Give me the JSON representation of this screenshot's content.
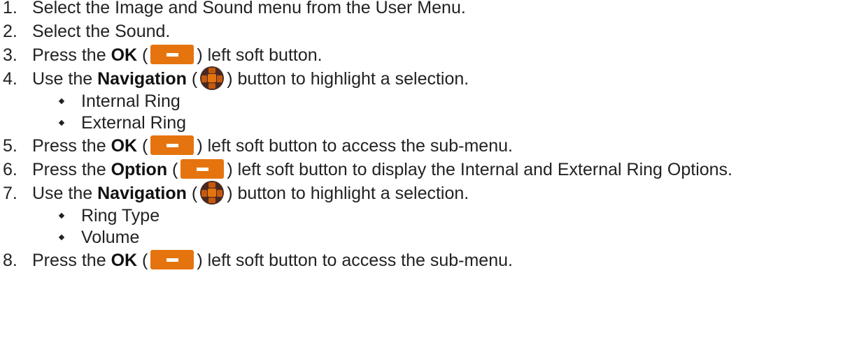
{
  "steps": [
    {
      "num": "1.",
      "text": "Select the Image and Sound menu from the User Menu."
    },
    {
      "num": "2.",
      "text": "Select the Sound."
    },
    {
      "num": "3.",
      "pre": "Press the ",
      "bold": "OK",
      "open": " (",
      "close": ") left soft button."
    },
    {
      "num": "4.",
      "pre": "Use the ",
      "bold": "Navigation",
      "open": " (",
      "close": ") button to highlight a selection.",
      "subitems": [
        "Internal Ring",
        "External Ring"
      ]
    },
    {
      "num": "5.",
      "pre": "Press the ",
      "bold": "OK",
      "open": " (",
      "close": ") left soft button to access the sub-menu."
    },
    {
      "num": "6.",
      "pre": "Press the ",
      "bold": "Option",
      "open": " (",
      "close": ") left soft button to display the Internal and External Ring Options."
    },
    {
      "num": "7.",
      "pre": "Use the ",
      "bold": "Navigation",
      "open": " (",
      "close": ") button to highlight a selection.",
      "subitems": [
        "Ring Type",
        "Volume"
      ]
    },
    {
      "num": "8.",
      "pre": "Press the ",
      "bold": "OK",
      "open": " (",
      "close": ") left soft button to access the sub-menu."
    }
  ],
  "icons": {
    "soft_button": "left-soft-button-icon",
    "navigation": "navigation-button-icon",
    "soft_button_color": "#e5740e",
    "navigation_color": "#4a2a20"
  }
}
